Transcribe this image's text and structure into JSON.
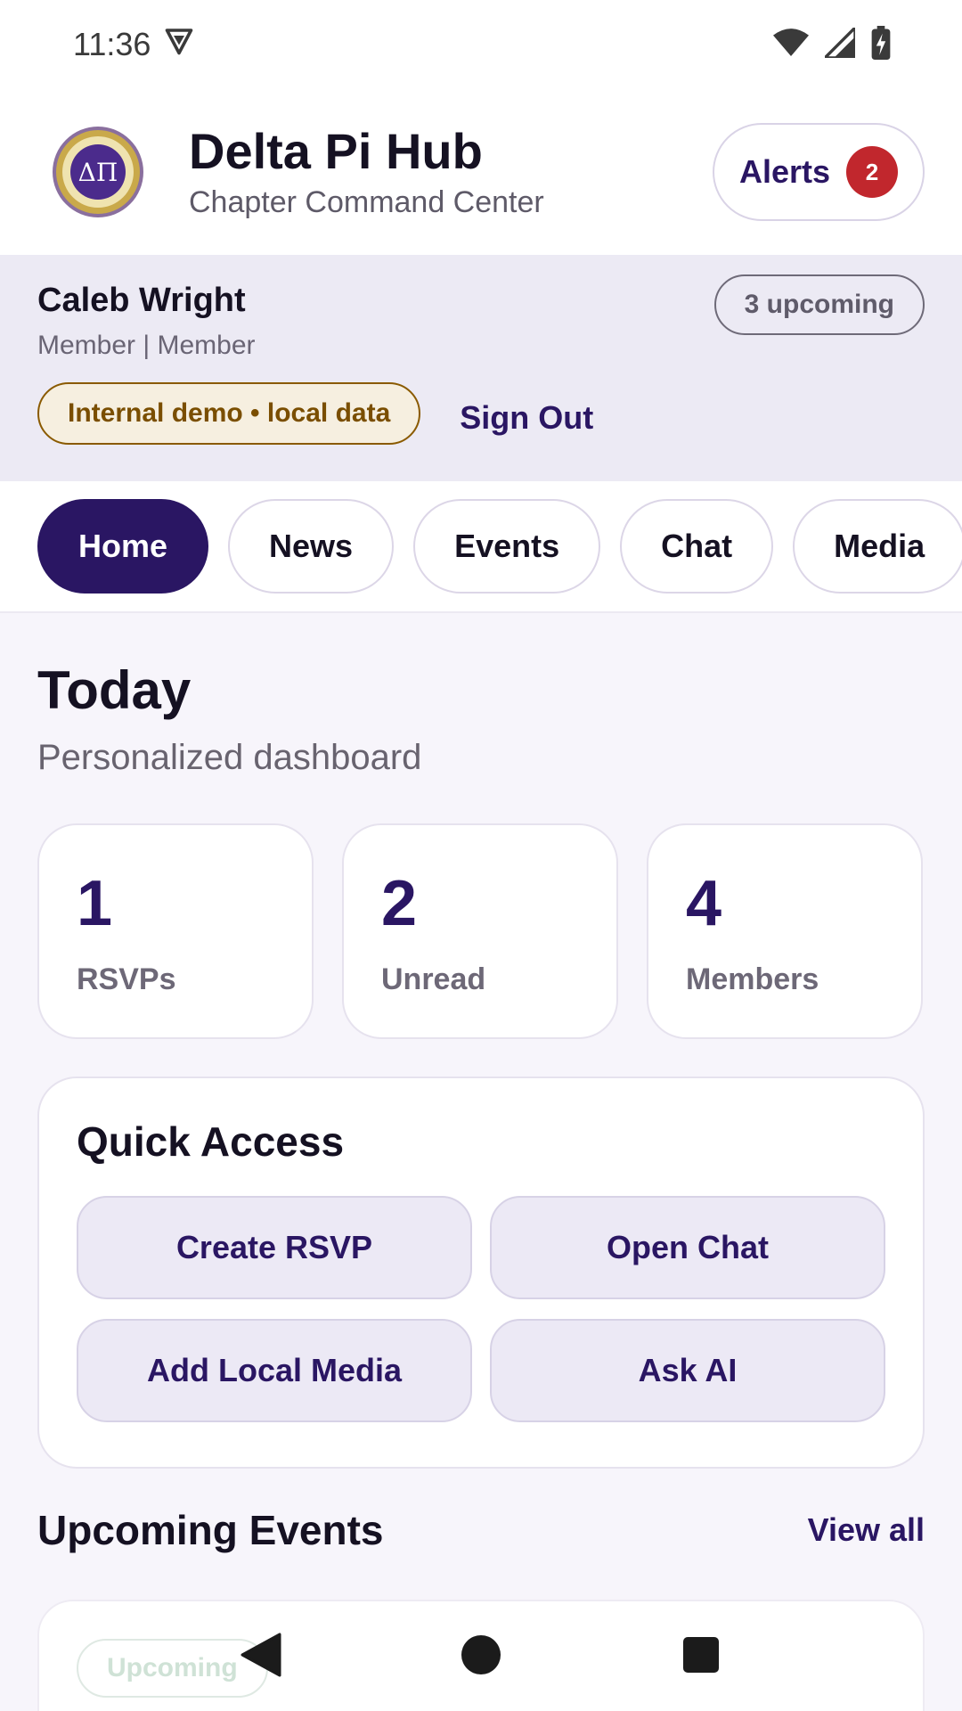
{
  "status": {
    "time": "11:36",
    "icons": [
      "vpn-shield-icon",
      "wifi-icon",
      "signal-icon",
      "battery-charging-icon"
    ]
  },
  "header": {
    "title": "Delta Pi Hub",
    "subtitle": "Chapter Command Center",
    "alerts_label": "Alerts",
    "alerts_count": "2"
  },
  "profile": {
    "name": "Caleb Wright",
    "role": "Member | Member",
    "upcoming": "3 upcoming",
    "demo_badge": "Internal demo • local data",
    "sign_out": "Sign Out"
  },
  "tabs": [
    {
      "label": "Home",
      "active": true
    },
    {
      "label": "News"
    },
    {
      "label": "Events"
    },
    {
      "label": "Chat"
    },
    {
      "label": "Media"
    }
  ],
  "today": {
    "title": "Today",
    "subtitle": "Personalized dashboard"
  },
  "stats": [
    {
      "value": "1",
      "label": "RSVPs"
    },
    {
      "value": "2",
      "label": "Unread"
    },
    {
      "value": "4",
      "label": "Members"
    }
  ],
  "quick_access": {
    "title": "Quick Access",
    "buttons": [
      "Create RSVP",
      "Open Chat",
      "Add Local Media",
      "Ask AI"
    ]
  },
  "upcoming_events": {
    "title": "Upcoming Events",
    "view_all": "View all",
    "first_badge": "Upcoming"
  },
  "colors": {
    "brand": "#2a1663",
    "alert": "#c1272d",
    "demo_border": "#8a5a00",
    "background": "#f7f5fb"
  }
}
